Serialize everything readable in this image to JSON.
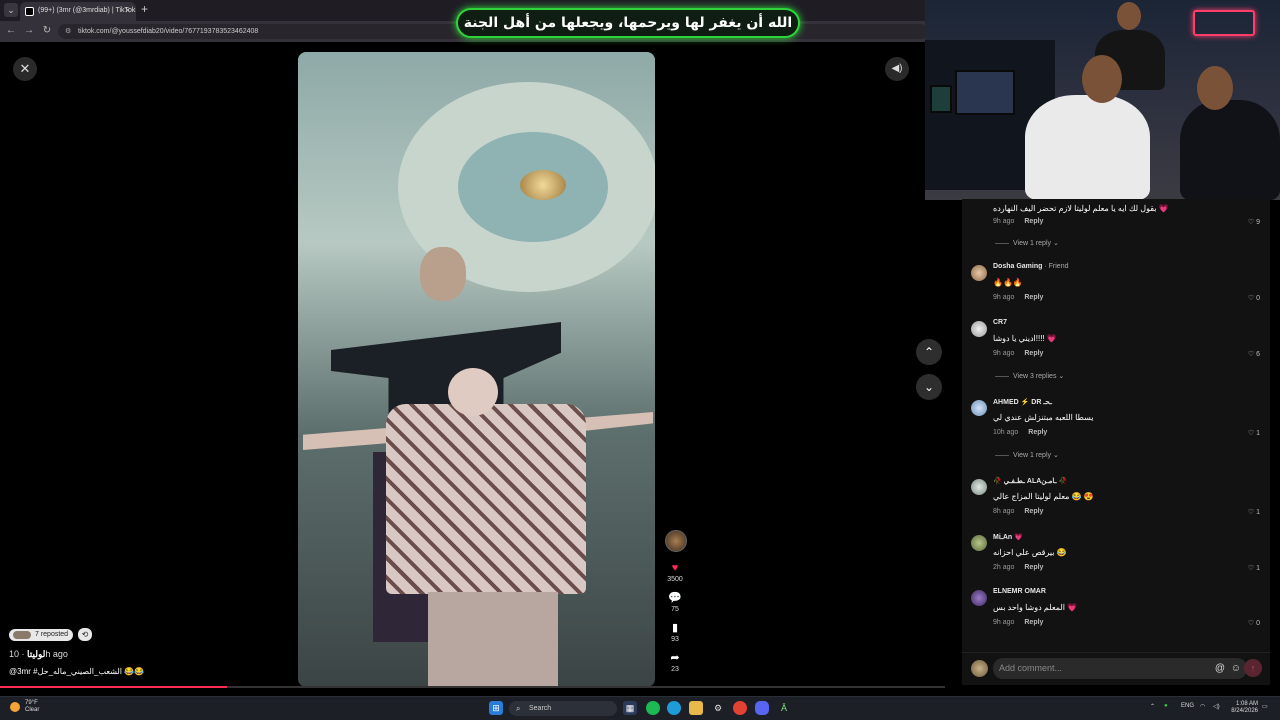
{
  "browser": {
    "tab_title": "(99+) (3mr (@3mrdiab) | TikTok",
    "url": "tiktok.com/@youssefdiab20/video/7677193783523462408"
  },
  "overlay_caption": "الله أن يغفر لها ويرحمها، ويجعلها من أهل الجنة",
  "post": {
    "repost_label": "7 reposted",
    "author": "لوليتا",
    "time_ago": "10h ago",
    "caption": "@3mr #الشعب_الصيني_ماله_حل 😂😂"
  },
  "actions": {
    "likes": "3500",
    "comments": "75",
    "saves": "93",
    "shares": "23",
    "progress": 0.24
  },
  "comments": [
    {
      "text": "بقول لك ايه يا معلم لوليتا لازم تحضر اليف النهارده 💗",
      "time": "9h ago",
      "likes": "9",
      "reply_label": "Reply",
      "view_replies": "View 1 reply"
    },
    {
      "user": "Dosha Gaming",
      "friend": "· Friend",
      "text": "🔥🔥🔥",
      "time": "9h ago",
      "likes": "0",
      "reply_label": "Reply"
    },
    {
      "user": "CR7",
      "text": "اديني يا دوشا!!!! 💗",
      "time": "9h ago",
      "likes": "6",
      "reply_label": "Reply",
      "view_replies": "View 3 replies"
    },
    {
      "user": "AHMED ⚡ DR ـحـ",
      "text": "يسطا اللعبه مبتنزلش عندي لي",
      "time": "10h ago",
      "likes": "1",
      "reply_label": "Reply",
      "view_replies": "View 1 reply"
    },
    {
      "user": "🥀 ـطـفـي ALAـامـن 🥀",
      "text": "معلم لوليتا المزاج عالي 😂 😍",
      "time": "8h ago",
      "likes": "1",
      "reply_label": "Reply"
    },
    {
      "user": "MiـAn 💗",
      "text": "بيرقص علي احزانه 😂",
      "time": "2h ago",
      "likes": "1",
      "reply_label": "Reply"
    },
    {
      "user": "ELNEMR OMAR",
      "text": "المعلم دوشا واحد بس 💗",
      "time": "9h ago",
      "likes": "0",
      "reply_label": "Reply"
    }
  ],
  "comment_input": {
    "placeholder": "Add comment..."
  },
  "taskbar": {
    "temp": "79°F",
    "condition": "Clear",
    "search": "Search",
    "lang": "ENG",
    "time": "1:08 AM",
    "date": "8/24/2026"
  },
  "colors": {
    "accent": "#ff2d55",
    "overlay_border": "#2fd43a",
    "panel": "#121212"
  }
}
